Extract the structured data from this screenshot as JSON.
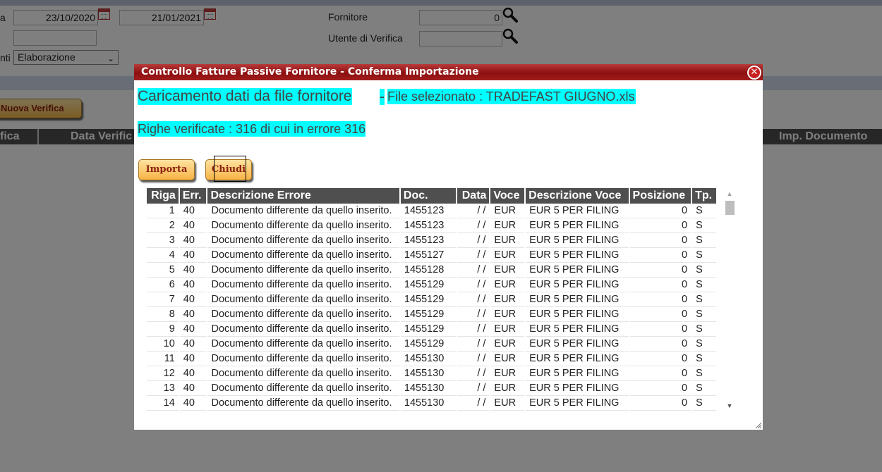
{
  "background": {
    "date_from": "23/10/2020",
    "date_to": "21/01/2021",
    "label_a": "a",
    "label_nti": "nti",
    "supplier_label": "Fornitore",
    "supplier_value": "0",
    "verify_user_label": "Utente di Verifica",
    "verify_user_value": "",
    "empty_field_value": "",
    "status_select": "Elaborazione",
    "new_verify_button": "Nuova Verifica",
    "grid_columns": [
      "fica",
      "Data Verific",
      "Imp. Documento"
    ]
  },
  "dialog": {
    "title": "Controllo Fatture Passive Fornitore - Conferma Importazione",
    "heading": "Caricamento dati da file fornitore",
    "heading_sep": "-",
    "file_selected": "File selezionato : TRADEFAST GIUGNO.xls",
    "summary": "Righe verificate : 316 di cui in errore 316",
    "import_button": "Importa",
    "close_button": "Chiudi",
    "colors": {
      "title_bar": "#9a1616",
      "highlight": "#00ffff",
      "button": "#f7b347",
      "header": "#4f4f4f"
    }
  },
  "table": {
    "columns": [
      "Riga",
      "Err.",
      "Descrizione Errore",
      "Doc.",
      "Data",
      "Voce",
      "Descrizione Voce",
      "Posizione",
      "Tp."
    ],
    "rows": [
      [
        "1",
        "40",
        "Documento differente da quello inserito.",
        "1455123",
        "/ /",
        "EUR",
        "EUR 5 PER FILING",
        "0",
        "S"
      ],
      [
        "2",
        "40",
        "Documento differente da quello inserito.",
        "1455123",
        "/ /",
        "EUR",
        "EUR 5 PER FILING",
        "0",
        "S"
      ],
      [
        "3",
        "40",
        "Documento differente da quello inserito.",
        "1455123",
        "/ /",
        "EUR",
        "EUR 5 PER FILING",
        "0",
        "S"
      ],
      [
        "4",
        "40",
        "Documento differente da quello inserito.",
        "1455127",
        "/ /",
        "EUR",
        "EUR 5 PER FILING",
        "0",
        "S"
      ],
      [
        "5",
        "40",
        "Documento differente da quello inserito.",
        "1455128",
        "/ /",
        "EUR",
        "EUR 5 PER FILING",
        "0",
        "S"
      ],
      [
        "6",
        "40",
        "Documento differente da quello inserito.",
        "1455129",
        "/ /",
        "EUR",
        "EUR 5 PER FILING",
        "0",
        "S"
      ],
      [
        "7",
        "40",
        "Documento differente da quello inserito.",
        "1455129",
        "/ /",
        "EUR",
        "EUR 5 PER FILING",
        "0",
        "S"
      ],
      [
        "8",
        "40",
        "Documento differente da quello inserito.",
        "1455129",
        "/ /",
        "EUR",
        "EUR 5 PER FILING",
        "0",
        "S"
      ],
      [
        "9",
        "40",
        "Documento differente da quello inserito.",
        "1455129",
        "/ /",
        "EUR",
        "EUR 5 PER FILING",
        "0",
        "S"
      ],
      [
        "10",
        "40",
        "Documento differente da quello inserito.",
        "1455129",
        "/ /",
        "EUR",
        "EUR 5 PER FILING",
        "0",
        "S"
      ],
      [
        "11",
        "40",
        "Documento differente da quello inserito.",
        "1455130",
        "/ /",
        "EUR",
        "EUR 5 PER FILING",
        "0",
        "S"
      ],
      [
        "12",
        "40",
        "Documento differente da quello inserito.",
        "1455130",
        "/ /",
        "EUR",
        "EUR 5 PER FILING",
        "0",
        "S"
      ],
      [
        "13",
        "40",
        "Documento differente da quello inserito.",
        "1455130",
        "/ /",
        "EUR",
        "EUR 5 PER FILING",
        "0",
        "S"
      ],
      [
        "14",
        "40",
        "Documento differente da quello inserito.",
        "1455130",
        "/ /",
        "EUR",
        "EUR 5 PER FILING",
        "0",
        "S"
      ]
    ]
  }
}
